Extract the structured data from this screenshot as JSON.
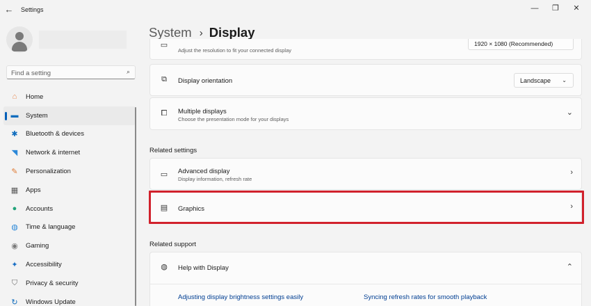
{
  "window": {
    "title": "Settings",
    "back_glyph": "←",
    "minimize_glyph": "—",
    "maximize_glyph": "❐",
    "close_glyph": "✕"
  },
  "search": {
    "placeholder": "Find a setting",
    "icon": "⌕"
  },
  "sidebar": {
    "items": [
      {
        "label": "Home",
        "icon": "home-icon",
        "glyph": "⌂",
        "color": "#e8874e"
      },
      {
        "label": "System",
        "icon": "system-icon",
        "glyph": "▬",
        "color": "#0f6cbd",
        "active": true
      },
      {
        "label": "Bluetooth & devices",
        "icon": "bluetooth-icon",
        "glyph": "✱",
        "color": "#0f6cbd"
      },
      {
        "label": "Network & internet",
        "icon": "wifi-icon",
        "glyph": "◥",
        "color": "#2b88d8"
      },
      {
        "label": "Personalization",
        "icon": "brush-icon",
        "glyph": "✎",
        "color": "#e07a34"
      },
      {
        "label": "Apps",
        "icon": "apps-icon",
        "glyph": "▦",
        "color": "#5b5b5b"
      },
      {
        "label": "Accounts",
        "icon": "accounts-icon",
        "glyph": "●",
        "color": "#22a37a"
      },
      {
        "label": "Time & language",
        "icon": "globe-icon",
        "glyph": "◍",
        "color": "#2b88d8"
      },
      {
        "label": "Gaming",
        "icon": "gamepad-icon",
        "glyph": "◉",
        "color": "#7a7a7a"
      },
      {
        "label": "Accessibility",
        "icon": "accessibility-icon",
        "glyph": "✦",
        "color": "#1a6fc4"
      },
      {
        "label": "Privacy & security",
        "icon": "shield-icon",
        "glyph": "⛉",
        "color": "#6b6b6b"
      },
      {
        "label": "Windows Update",
        "icon": "update-icon",
        "glyph": "↻",
        "color": "#0f6cbd"
      }
    ]
  },
  "breadcrumb": {
    "parent": "System",
    "separator": "›",
    "current": "Display"
  },
  "cards": {
    "resolution": {
      "subtitle": "Adjust the resolution to fit your connected display",
      "value": "1920 × 1080 (Recommended)"
    },
    "orientation": {
      "title": "Display orientation",
      "value": "Landscape"
    },
    "multiple_displays": {
      "title": "Multiple displays",
      "subtitle": "Choose the presentation mode for your displays"
    },
    "advanced_display": {
      "title": "Advanced display",
      "subtitle": "Display information, refresh rate"
    },
    "graphics": {
      "title": "Graphics"
    },
    "help": {
      "title": "Help with Display"
    }
  },
  "sections": {
    "related_settings": "Related settings",
    "related_support": "Related support"
  },
  "links": [
    "Adjusting display brightness settings easily",
    "Syncing refresh rates for smooth playback"
  ],
  "glyphs": {
    "chevron_right": "›",
    "chevron_down": "⌄",
    "chevron_up": "⌃",
    "dd_arrow": "⌄"
  },
  "colors": {
    "accent": "#005fb8",
    "highlight": "#d1212c",
    "link": "#003e92"
  }
}
